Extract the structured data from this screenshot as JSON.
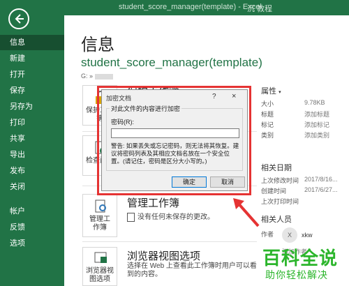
{
  "window": {
    "title": "student_score_manager(template)  -  Excel",
    "tail": "沉 教程"
  },
  "sidebar": {
    "items": [
      {
        "label": "信息",
        "active": true
      },
      {
        "label": "新建"
      },
      {
        "label": "打开"
      },
      {
        "label": "保存"
      },
      {
        "label": "另存为"
      },
      {
        "label": "打印"
      },
      {
        "label": "共享"
      },
      {
        "label": "导出"
      },
      {
        "label": "发布"
      },
      {
        "label": "关闭"
      },
      {
        "label": "帐户"
      },
      {
        "label": "反馈"
      },
      {
        "label": "选项"
      }
    ]
  },
  "main": {
    "heading": "信息",
    "filename": "student_score_manager(template)",
    "path": "G: »",
    "protect": {
      "tile_label": "保护工作簿",
      "title": "保护工作簿"
    },
    "inspect": {
      "tile_label": "检查问题"
    },
    "manage": {
      "tile_label": "管理工作簿",
      "title": "管理工作簿",
      "desc": "没有任何未保存的更改。"
    },
    "browser": {
      "tile_label": "浏览器视图选项",
      "title": "浏览器视图选项",
      "desc": "选择在 Web 上查看此工作簿时用户可以看到的内容。"
    }
  },
  "properties": {
    "title": "属性",
    "rows": [
      {
        "k": "大小",
        "v": "9.78KB"
      },
      {
        "k": "标题",
        "v": "添加标题"
      },
      {
        "k": "标记",
        "v": "添加标记"
      },
      {
        "k": "类别",
        "v": "添加类别"
      }
    ],
    "dates_title": "相关日期",
    "dates": [
      {
        "k": "上次修改时间",
        "v": "2017/8/16..."
      },
      {
        "k": "创建时间",
        "v": "2017/6/27..."
      },
      {
        "k": "上次打印时间",
        "v": ""
      }
    ],
    "people_title": "相关人员",
    "author_label": "作者",
    "author_initial": "X",
    "author_name": "xkw",
    "add_author": "添加作者"
  },
  "dialog": {
    "title": "加密文档",
    "help": "?",
    "close": "×",
    "group_label": "对此文件的内容进行加密",
    "password_label": "密码(R):",
    "password_value": "",
    "warning": "警告: 如果丢失或忘记密码，则无法将其恢复。建议将密码列表及其相应文档名放在一个安全位置。(请记住，密码是区分大小写的。)",
    "ok": "确定",
    "cancel": "取消"
  },
  "watermark": {
    "big": "百科全说",
    "small": "助你轻松解决"
  },
  "colors": {
    "excel_green": "#217346",
    "highlight_red": "#e53333",
    "watermark_green": "#2bb52b"
  }
}
